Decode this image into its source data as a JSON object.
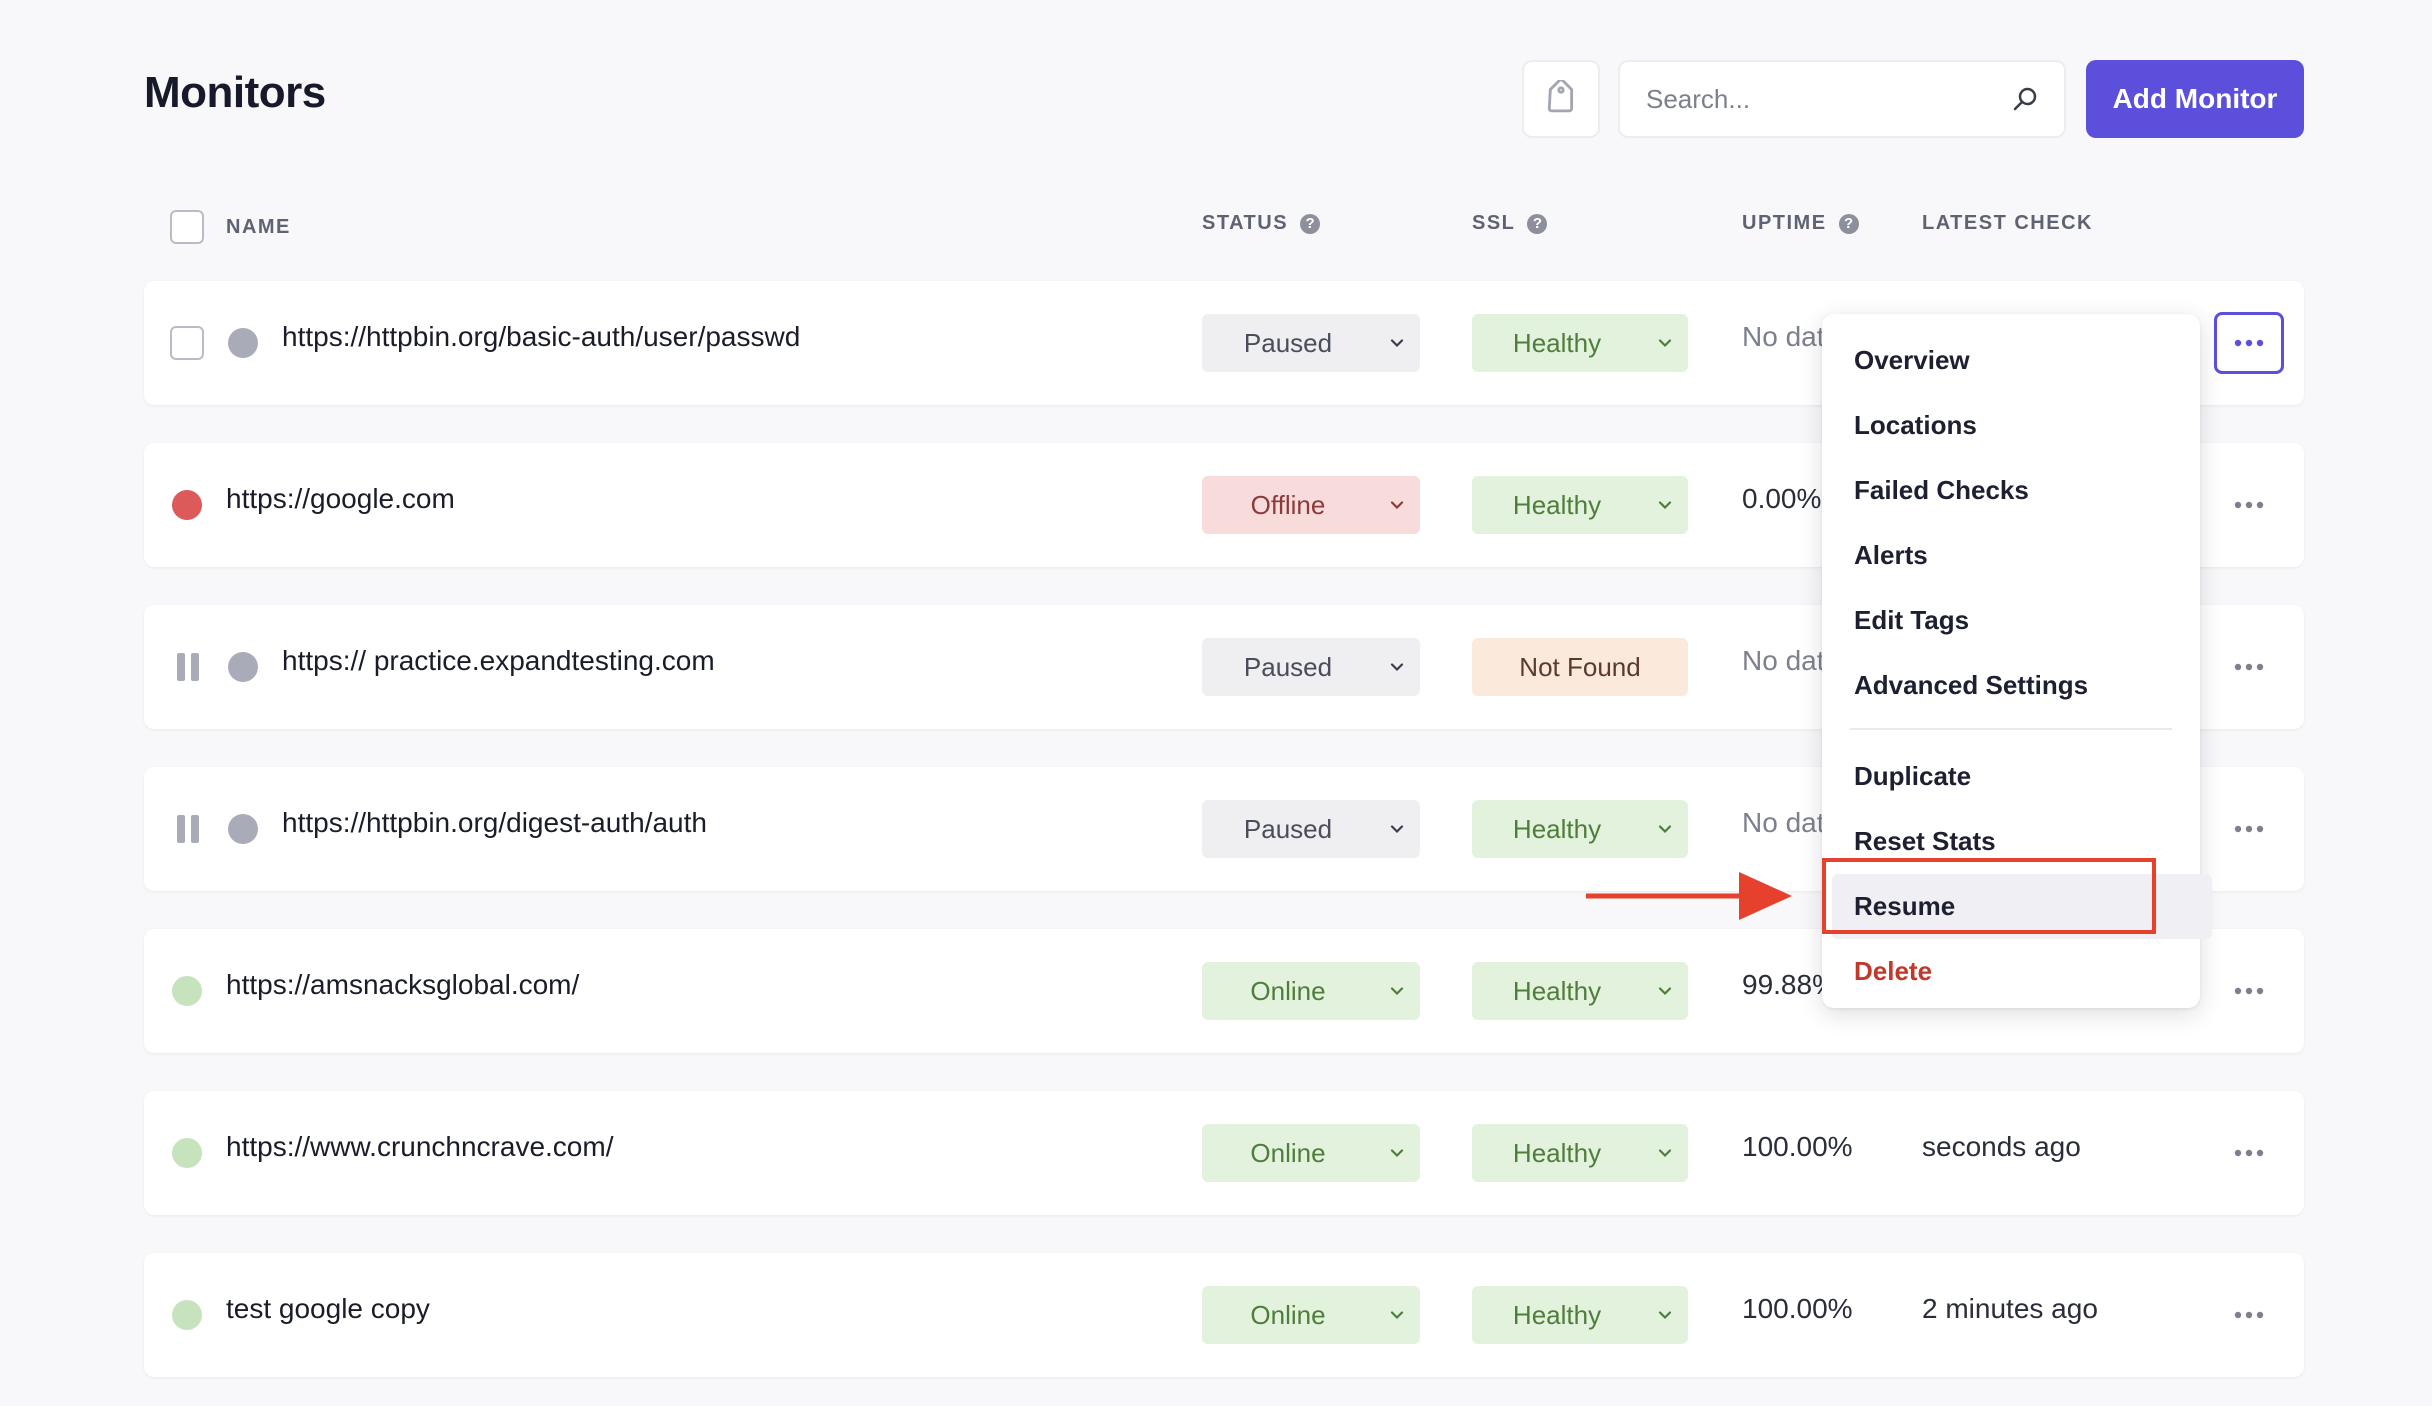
{
  "header": {
    "title": "Monitors",
    "search_placeholder": "Search...",
    "add_button": "Add Monitor",
    "tag_icon": "tag-icon",
    "search_icon": "search-icon"
  },
  "columns": {
    "name": "NAME",
    "status": "STATUS",
    "ssl": "SSL",
    "uptime": "UPTIME",
    "latest_check": "LATEST CHECK",
    "help_glyph": "?"
  },
  "rows": [
    {
      "name": "https://httpbin.org/basic-auth/user/passwd",
      "status": "Paused",
      "ssl": "Healthy",
      "uptime": "No data",
      "latest": "",
      "indicator": "grey",
      "lead": "checkbox"
    },
    {
      "name": "https://google.com",
      "status": "Offline",
      "ssl": "Healthy",
      "uptime": "0.00%",
      "latest": "",
      "indicator": "red",
      "lead": "none"
    },
    {
      "name": "https:// practice.expandtesting.com",
      "status": "Paused",
      "ssl": "Not Found",
      "uptime": "No data",
      "latest": "",
      "indicator": "grey",
      "lead": "pause"
    },
    {
      "name": "https://httpbin.org/digest-auth/auth",
      "status": "Paused",
      "ssl": "Healthy",
      "uptime": "No data",
      "latest": "",
      "indicator": "grey",
      "lead": "pause"
    },
    {
      "name": "https://amsnacksglobal.com/",
      "status": "Online",
      "ssl": "Healthy",
      "uptime": "99.88%",
      "latest": "",
      "indicator": "green",
      "lead": "none"
    },
    {
      "name": "https://www.crunchncrave.com/",
      "status": "Online",
      "ssl": "Healthy",
      "uptime": "100.00%",
      "latest": "seconds ago",
      "indicator": "green",
      "lead": "none"
    },
    {
      "name": "test google copy",
      "status": "Online",
      "ssl": "Healthy",
      "uptime": "100.00%",
      "latest": "2 minutes ago",
      "indicator": "green",
      "lead": "none"
    }
  ],
  "menu": {
    "items": [
      "Overview",
      "Locations",
      "Failed Checks",
      "Alerts",
      "Edit Tags",
      "Advanced Settings"
    ],
    "items2": [
      "Duplicate",
      "Reset Stats",
      "Resume"
    ],
    "danger": "Delete",
    "highlighted": "Resume"
  },
  "colors": {
    "accent": "#5b4fdb",
    "paused_bg": "#efeff1",
    "offline_bg": "#f8dcdc",
    "online_bg": "#e3f2dd",
    "notfound_bg": "#fbe9dc",
    "dot_grey": "#a9acb8",
    "dot_red": "#dd5a5a",
    "dot_green": "#c6e3bd",
    "annotation": "#e5412d"
  }
}
